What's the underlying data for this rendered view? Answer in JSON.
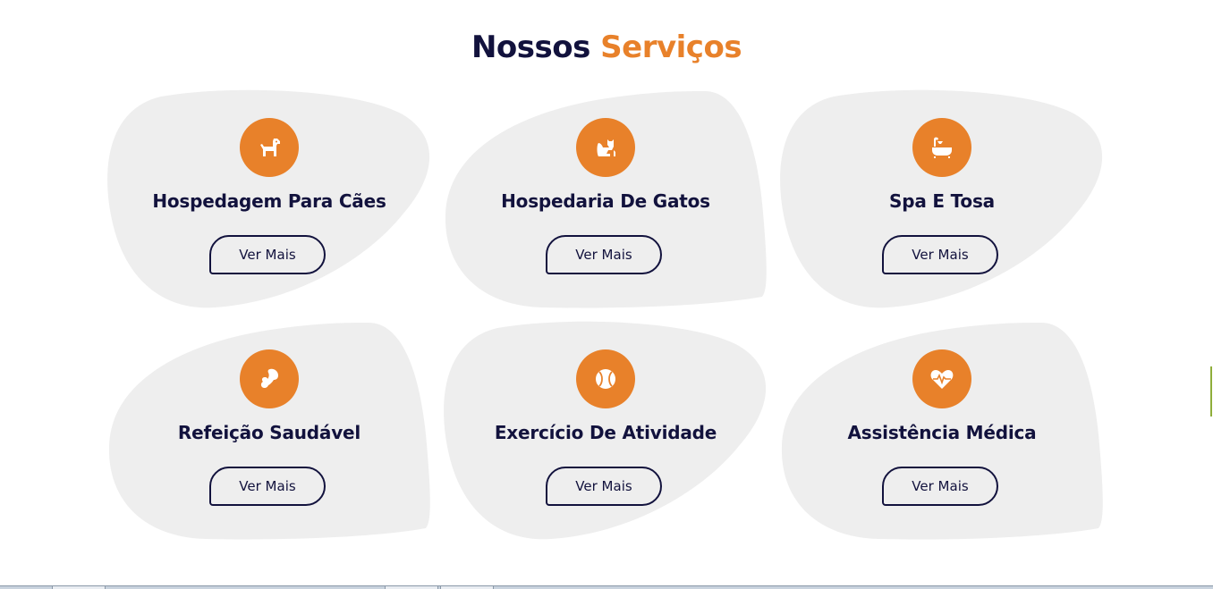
{
  "header": {
    "title_part1": "Nossos",
    "title_part2": "Serviços"
  },
  "colors": {
    "accent": "#e8812a",
    "navy": "#12123d",
    "card_bg": "#eeeeee"
  },
  "services": [
    {
      "title": "Hospedagem Para Cães",
      "icon": "dog-icon",
      "button": "Ver Mais"
    },
    {
      "title": "Hospedaria De Gatos",
      "icon": "cat-icon",
      "button": "Ver Mais"
    },
    {
      "title": "Spa E Tosa",
      "icon": "bathtub-icon",
      "button": "Ver Mais"
    },
    {
      "title": "Refeição Saudável",
      "icon": "bone-icon",
      "button": "Ver Mais"
    },
    {
      "title": "Exercício De Atividade",
      "icon": "ball-icon",
      "button": "Ver Mais"
    },
    {
      "title": "Assistência Médica",
      "icon": "heart-pulse-icon",
      "button": "Ver Mais"
    }
  ]
}
